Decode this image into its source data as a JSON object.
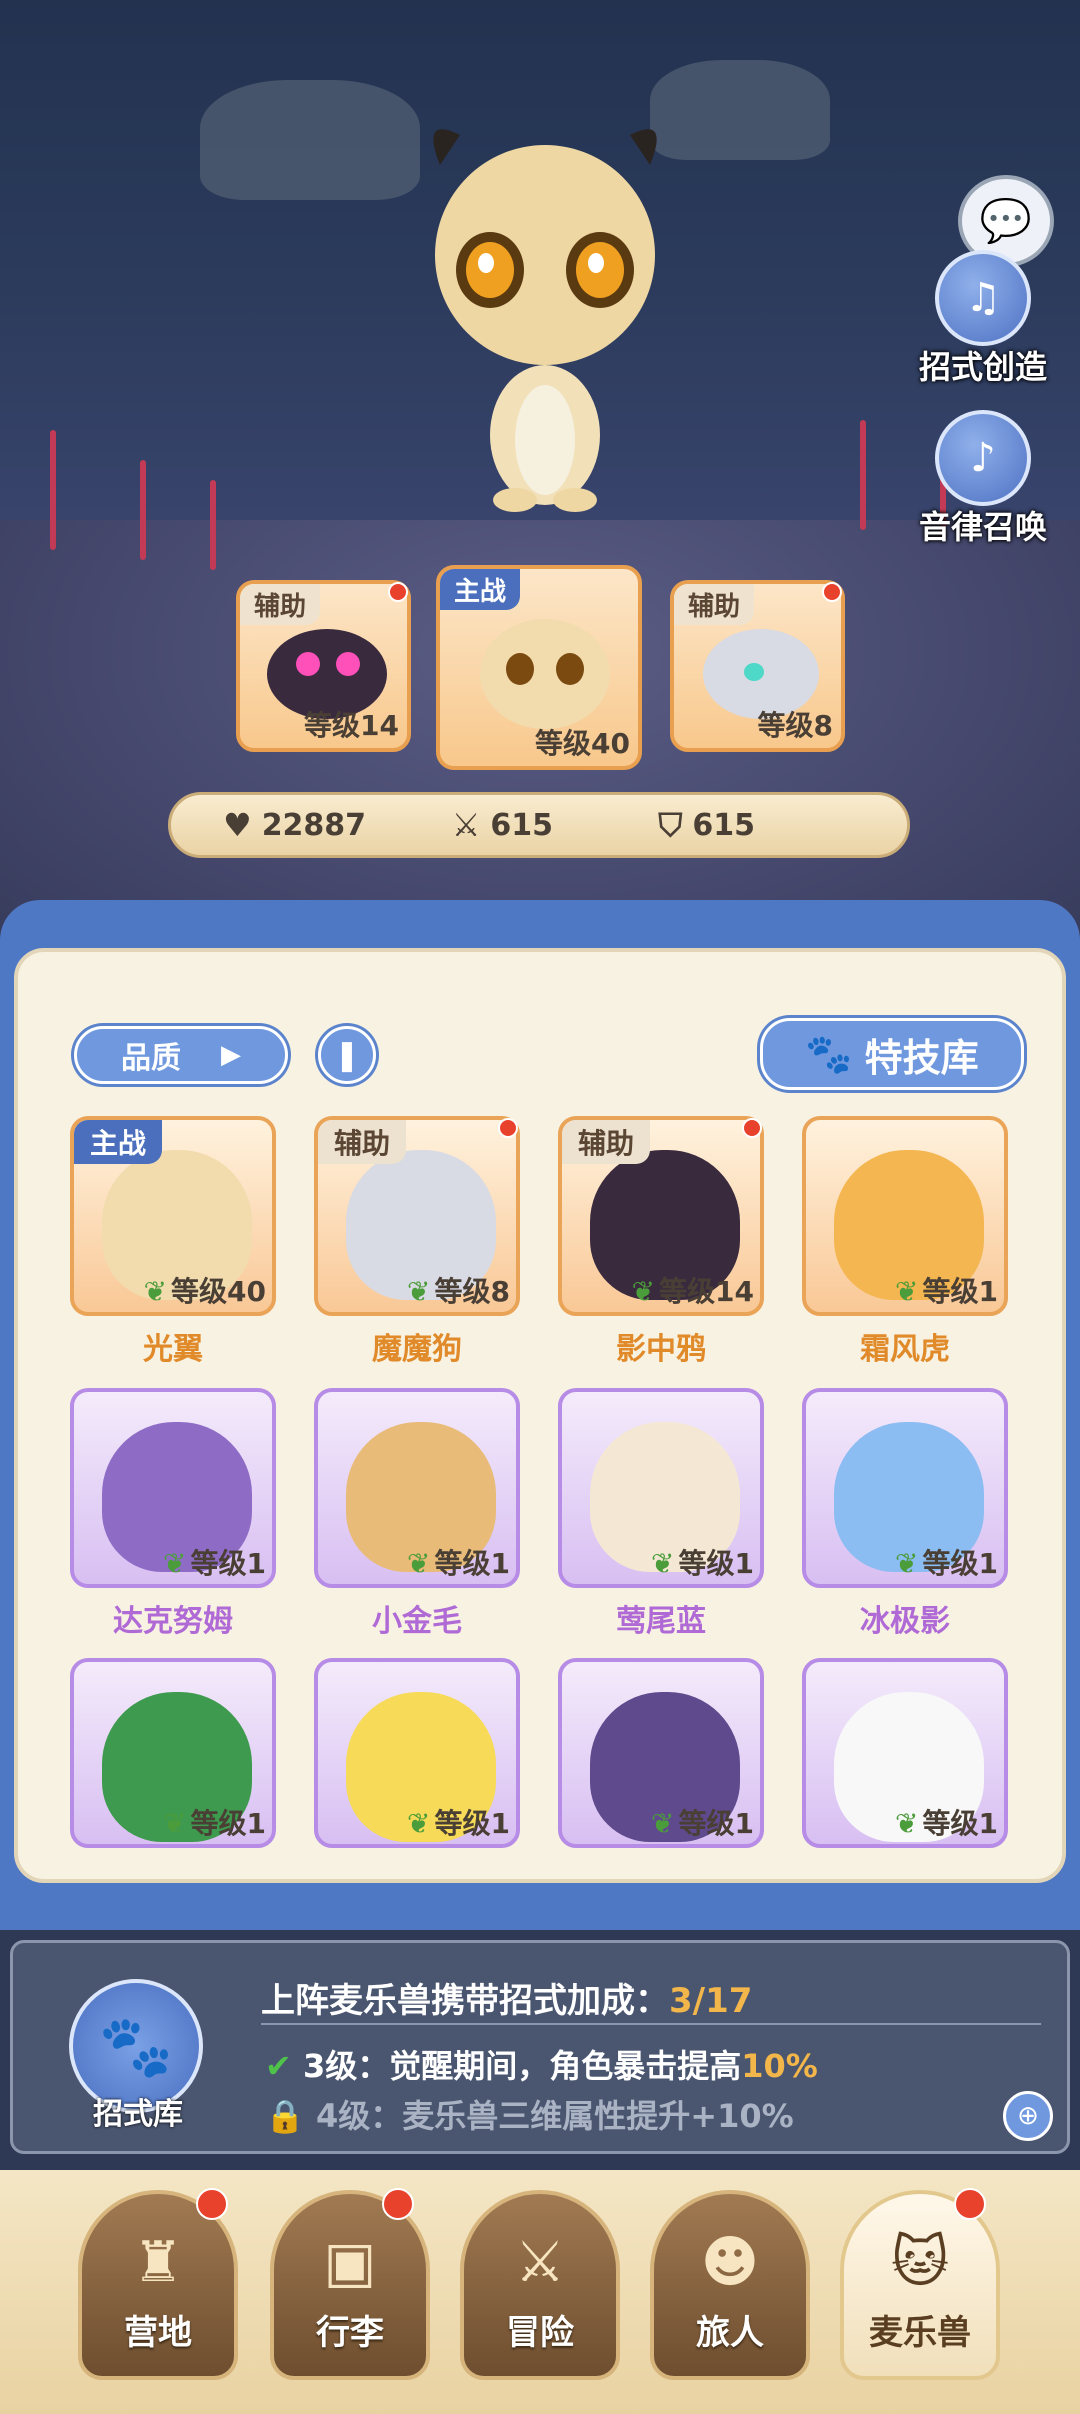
{
  "side_buttons": {
    "create": "招式创造",
    "summon": "音律召唤"
  },
  "team": [
    {
      "tag": "辅助",
      "level_label": "等级14",
      "main": false
    },
    {
      "tag": "主战",
      "level_label": "等级40",
      "main": true
    },
    {
      "tag": "辅助",
      "level_label": "等级8",
      "main": false
    }
  ],
  "stats": {
    "hp": "22887",
    "attack": "615",
    "defense": "615"
  },
  "filter": {
    "quality_label": "品质"
  },
  "skill_lib_button": "特技库",
  "pets": [
    {
      "name": "光翼",
      "level_label": "等级40",
      "tag": "主战",
      "rarity": "gold",
      "color": "#f2dcae"
    },
    {
      "name": "魔魔狗",
      "level_label": "等级8",
      "tag": "辅助",
      "rarity": "gold",
      "color": "#d8dae4"
    },
    {
      "name": "影中鸦",
      "level_label": "等级14",
      "tag": "辅助",
      "rarity": "gold",
      "color": "#3a2a3e"
    },
    {
      "name": "霜风虎",
      "level_label": "等级1",
      "tag": "",
      "rarity": "gold",
      "color": "#f4b650"
    },
    {
      "name": "达克努姆",
      "level_label": "等级1",
      "tag": "",
      "rarity": "purple",
      "color": "#8e6cc6"
    },
    {
      "name": "小金毛",
      "level_label": "等级1",
      "tag": "",
      "rarity": "purple",
      "color": "#e8bb78"
    },
    {
      "name": "莺尾蓝",
      "level_label": "等级1",
      "tag": "",
      "rarity": "purple",
      "color": "#f4e8d4"
    },
    {
      "name": "冰极影",
      "level_label": "等级1",
      "tag": "",
      "rarity": "purple",
      "color": "#8bbcf2"
    },
    {
      "name": "",
      "level_label": "等级1",
      "tag": "",
      "rarity": "purple",
      "color": "#3e9a4e"
    },
    {
      "name": "",
      "level_label": "等级1",
      "tag": "",
      "rarity": "purple",
      "color": "#f6da58"
    },
    {
      "name": "",
      "level_label": "等级1",
      "tag": "",
      "rarity": "purple",
      "color": "#5e4a8c"
    },
    {
      "name": "",
      "level_label": "等级1",
      "tag": "",
      "rarity": "purple",
      "color": "#f8f8f8"
    }
  ],
  "move_bonus": {
    "title": "上阵麦乐兽携带招式加成：",
    "progress": "3/17",
    "lib_label": "招式库",
    "lines": [
      {
        "prefix": "3级：",
        "text": "觉醒期间，角色暴击提高",
        "highlight": "10%",
        "done": true
      },
      {
        "prefix": "4级：",
        "text": "麦乐兽三维属性提升+10%",
        "highlight": "",
        "done": false
      }
    ]
  },
  "nav": [
    "营地",
    "行李",
    "冒险",
    "旅人",
    "麦乐兽"
  ],
  "active_nav": "麦乐兽"
}
